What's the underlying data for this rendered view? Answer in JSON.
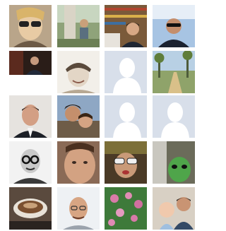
{
  "friends_grid": {
    "rows": 5,
    "columns": 4,
    "tiles": [
      {
        "kind": "photo",
        "subject": "woman-sunglasses"
      },
      {
        "kind": "photo",
        "subject": "person-with-tree"
      },
      {
        "kind": "photo",
        "subject": "man-bookshelf"
      },
      {
        "kind": "photo",
        "subject": "man-sunglasses-sky"
      },
      {
        "kind": "photo",
        "subject": "man-dark-room"
      },
      {
        "kind": "photo",
        "subject": "woman-smiling-bw"
      },
      {
        "kind": "default-avatar"
      },
      {
        "kind": "photo",
        "subject": "palm-road"
      },
      {
        "kind": "photo",
        "subject": "man-suit"
      },
      {
        "kind": "photo",
        "subject": "couple-selfie"
      },
      {
        "kind": "default-avatar"
      },
      {
        "kind": "default-avatar"
      },
      {
        "kind": "photo",
        "subject": "old-man-glasses"
      },
      {
        "kind": "photo",
        "subject": "man-closeup"
      },
      {
        "kind": "photo",
        "subject": "woman-sunglasses-group"
      },
      {
        "kind": "photo",
        "subject": "alien-mask"
      },
      {
        "kind": "photo",
        "subject": "coffee-cup"
      },
      {
        "kind": "photo",
        "subject": "bald-man-glasses"
      },
      {
        "kind": "photo",
        "subject": "pink-flowers"
      },
      {
        "kind": "photo",
        "subject": "man-with-baby"
      }
    ]
  },
  "colors": {
    "placeholder_bg": "#d8dfea",
    "placeholder_figure": "#ffffff"
  }
}
